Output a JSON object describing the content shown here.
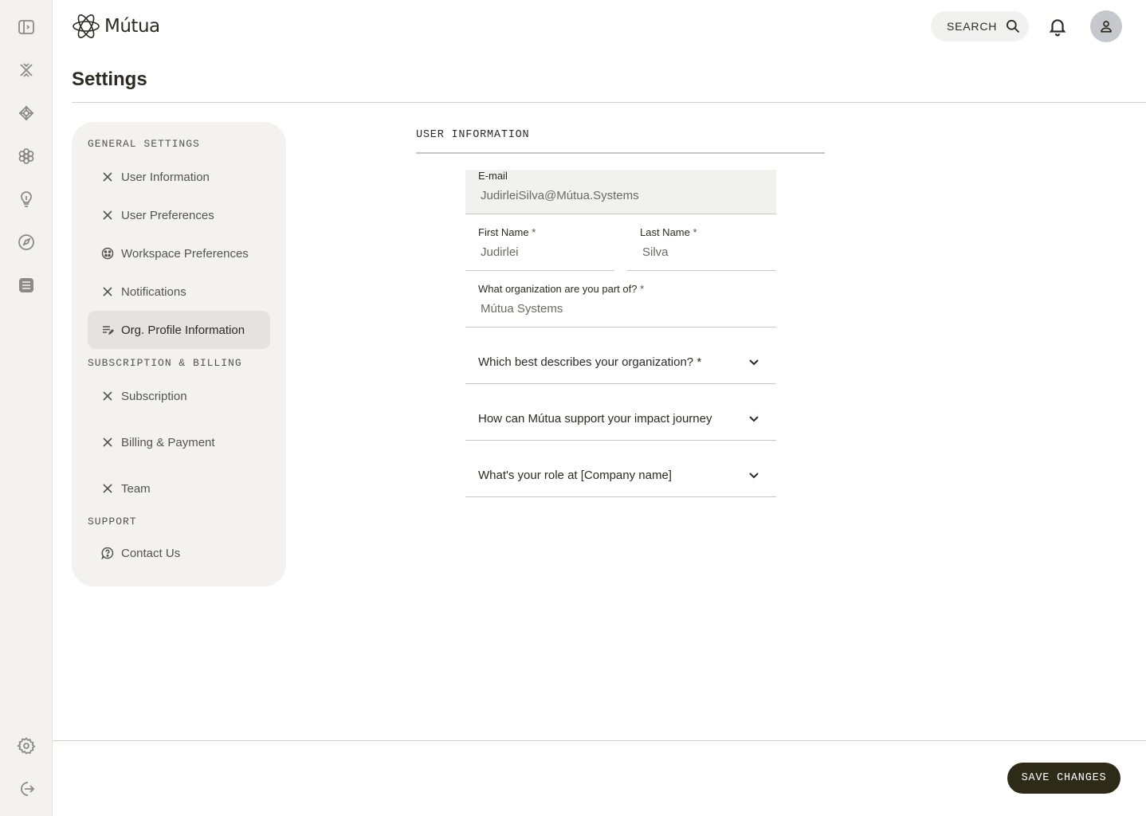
{
  "app": {
    "brand": "Mútua"
  },
  "rail": {
    "top_icons": [
      "sidebar-toggle-icon",
      "close-x-icon",
      "network-icon",
      "flower-icon",
      "lightbulb-icon",
      "compass-icon",
      "document-icon"
    ],
    "bottom_icons": [
      "gear-icon",
      "logout-icon"
    ]
  },
  "header": {
    "search_label": "SEARCH"
  },
  "page": {
    "title": "Settings"
  },
  "nav": {
    "sections": [
      {
        "title": "GENERAL SETTINGS"
      },
      {
        "title": "SUBSCRIPTION & BILLING"
      },
      {
        "title": "SUPPORT"
      }
    ],
    "items": [
      {
        "label": "User Information",
        "icon": "close-x-icon"
      },
      {
        "label": "User Preferences",
        "icon": "close-x-icon"
      },
      {
        "label": "Workspace Preferences",
        "icon": "palette-icon"
      },
      {
        "label": "Notifications",
        "icon": "close-x-icon"
      },
      {
        "label": "Org. Profile Information",
        "icon": "edit-list-icon",
        "active": true
      },
      {
        "label": "Subscription",
        "icon": "close-x-icon"
      },
      {
        "label": "Billing & Payment",
        "icon": "close-x-icon"
      },
      {
        "label": "Team",
        "icon": "close-x-icon"
      },
      {
        "label": "Contact Us",
        "icon": "help-icon"
      }
    ]
  },
  "form": {
    "header": "USER INFORMATION",
    "email": {
      "label": "E-mail",
      "value": "JudirleiSilva@Mútua.Systems"
    },
    "first_name": {
      "label": "First Name",
      "required": "*",
      "value": "Judirlei"
    },
    "last_name": {
      "label": "Last Name",
      "required": "*",
      "value": "Silva"
    },
    "organization": {
      "label": "What organization are you part of?",
      "required": "*",
      "value": "Mútua Systems"
    },
    "org_type": {
      "label": "Which best describes your organization?",
      "required": "*"
    },
    "support": {
      "label": "How can Mútua support your impact journey"
    },
    "role": {
      "label": "What's your role at [Company name]"
    }
  },
  "footer": {
    "save_label": "SAVE CHANGES"
  },
  "colors": {
    "accent": "#2d2a18",
    "panel": "#f3f2ef",
    "text": "#2d2a22"
  }
}
